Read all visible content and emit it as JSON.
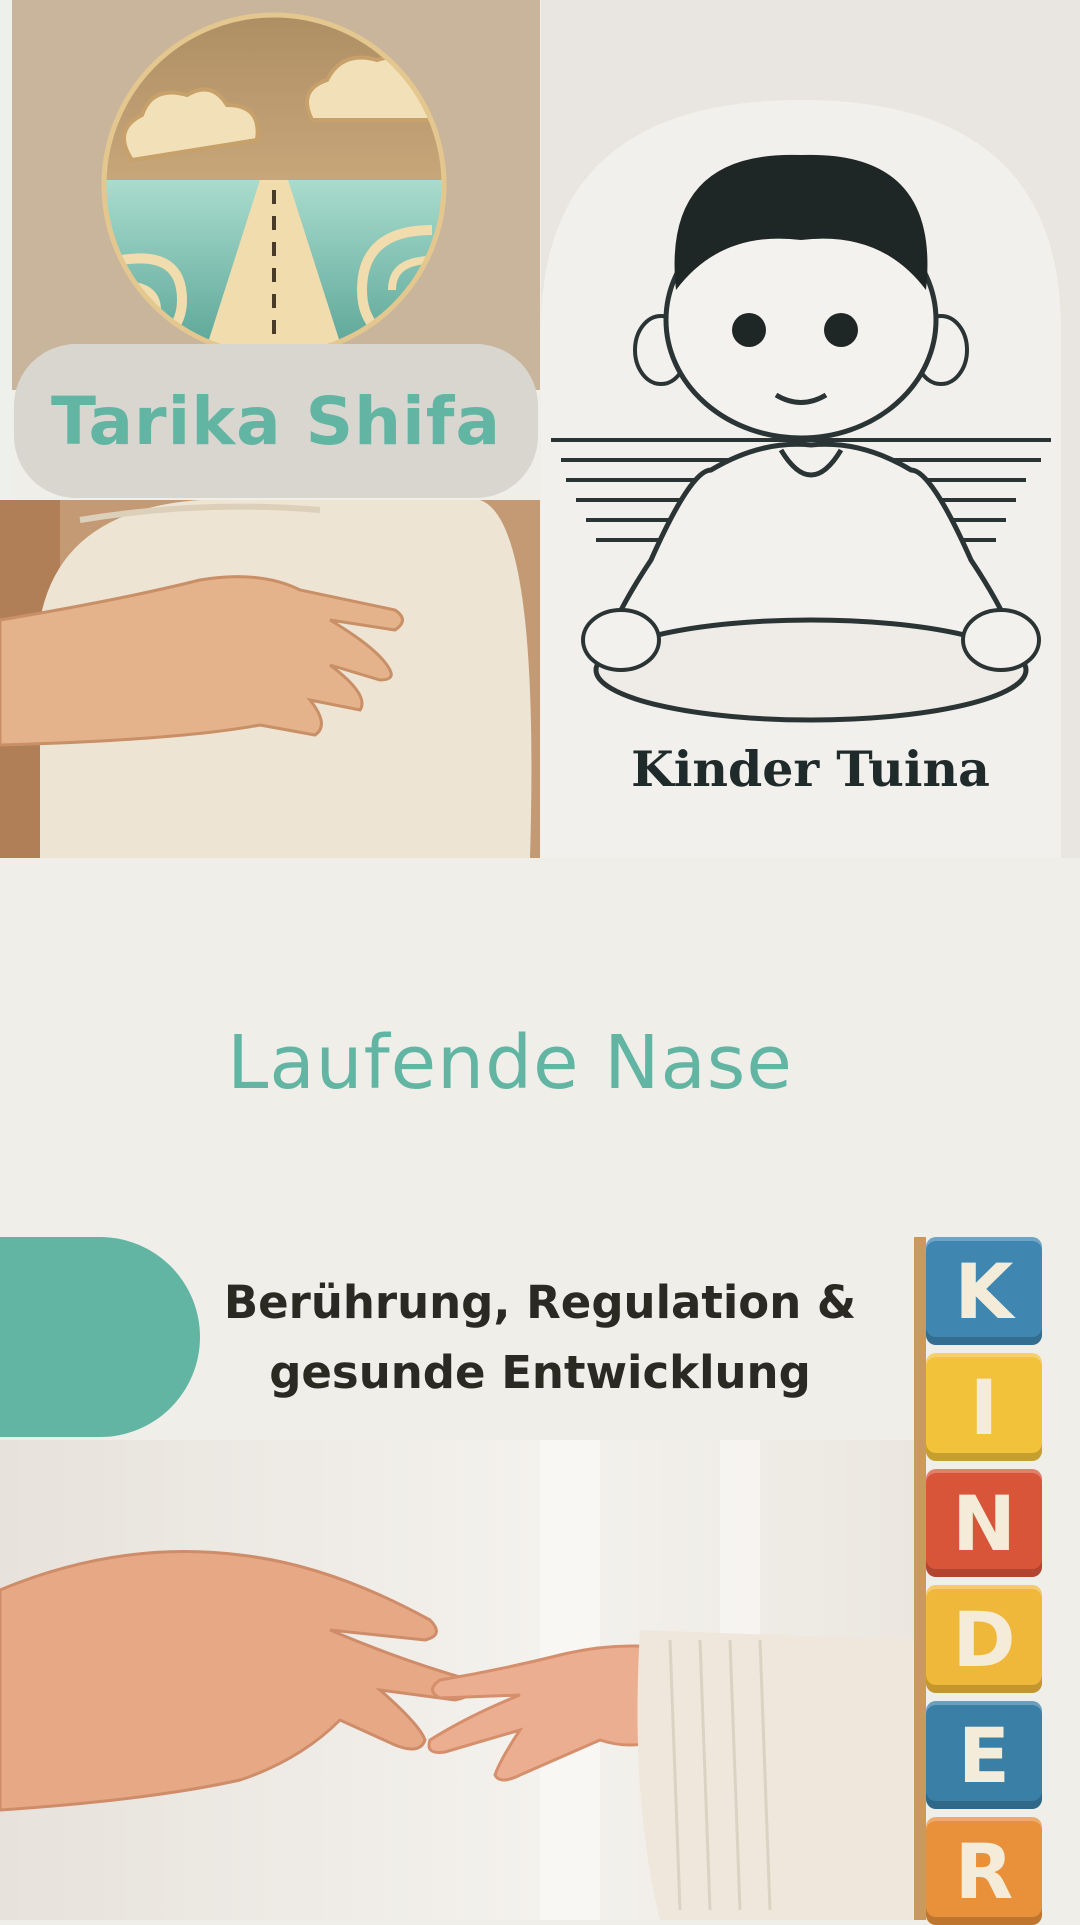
{
  "brand": {
    "name": "Tarika Shifa"
  },
  "illustration": {
    "caption": "Kinder Tuina"
  },
  "headline": "Laufende Nase",
  "subtitle": {
    "line1": "Berührung, Regulation &",
    "line2": "gesunde Entwicklung"
  },
  "blocks": {
    "letters": [
      "K",
      "I",
      "N",
      "D",
      "E",
      "R"
    ],
    "colors": [
      "#3f86b0",
      "#f2c23a",
      "#d9553a",
      "#f0b83a",
      "#3a7fa6",
      "#e8913a"
    ]
  },
  "colors": {
    "accent": "#63b5a3",
    "background": "#efeee9",
    "text_dark": "#2a2a22"
  }
}
